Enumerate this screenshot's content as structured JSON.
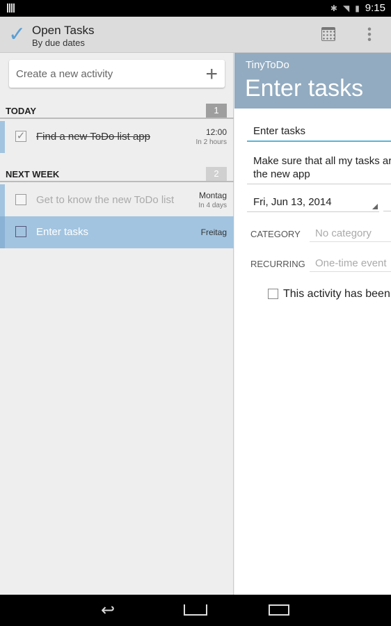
{
  "status_bar": {
    "time": "9:15"
  },
  "action_bar": {
    "title": "Open Tasks",
    "subtitle": "By due dates"
  },
  "left": {
    "create_placeholder": "Create a new activity",
    "sections": [
      {
        "label": "TODAY",
        "count": "1",
        "count_color": "#9e9e9e",
        "tasks": [
          {
            "title": "Find a new ToDo list app",
            "done": true,
            "due": "12:00",
            "relative": "In 2 hours"
          }
        ]
      },
      {
        "label": "NEXT WEEK",
        "count": "2",
        "count_color": "#d0d0d0",
        "tasks": [
          {
            "title": "Get to know the new ToDo list",
            "done": false,
            "due": "Montag",
            "relative": "In 4 days"
          },
          {
            "title": "Enter tasks",
            "done": false,
            "due": "Freitag",
            "relative": "",
            "selected": true
          }
        ]
      }
    ]
  },
  "detail": {
    "app_name": "TinyToDo",
    "heading": "Enter tasks",
    "title_value": "Enter tasks",
    "description_line1": "Make sure that all my tasks are",
    "description_line2": "the new app",
    "date": "Fri, Jun 13, 2014",
    "category_label": "CATEGORY",
    "category_value": "No category",
    "recurring_label": "RECURRING",
    "recurring_value": "One-time event",
    "completed_label": "This activity has been completed"
  },
  "colors": {
    "accent": "#5a9fd4",
    "selected_row": "#a2c4e0",
    "detail_header": "#92abc0"
  }
}
